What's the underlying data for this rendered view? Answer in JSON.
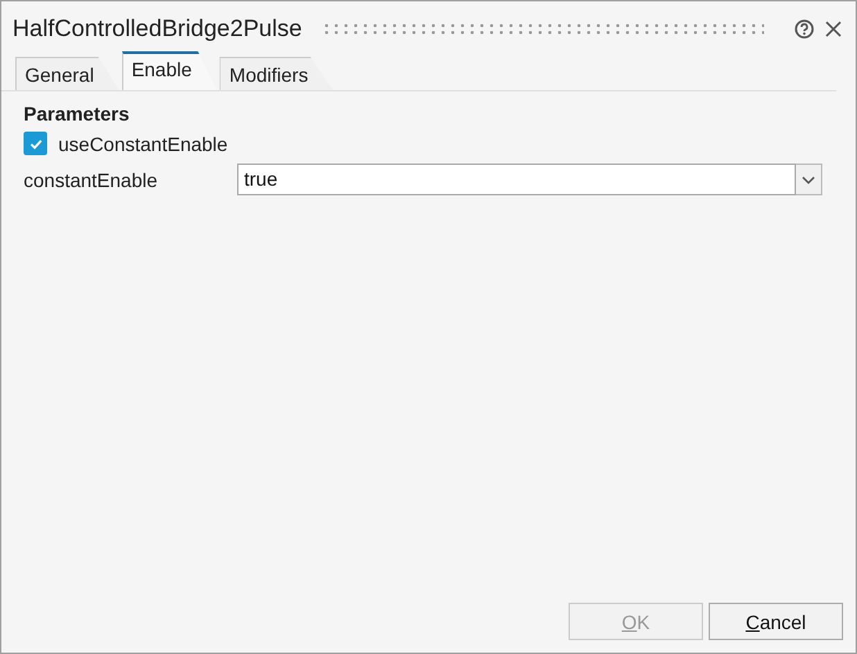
{
  "window": {
    "title": "HalfControlledBridge2Pulse"
  },
  "tabs": [
    {
      "label": "General",
      "selected": false
    },
    {
      "label": "Enable",
      "selected": true
    },
    {
      "label": "Modifiers",
      "selected": false
    }
  ],
  "section": {
    "title": "Parameters"
  },
  "checkbox": {
    "label": "useConstantEnable",
    "checked": true
  },
  "field": {
    "label": "constantEnable",
    "value": "true"
  },
  "buttons": [
    {
      "access_key": "O",
      "rest": "K",
      "disabled": true
    },
    {
      "access_key": "C",
      "rest": "ancel",
      "disabled": false
    }
  ]
}
